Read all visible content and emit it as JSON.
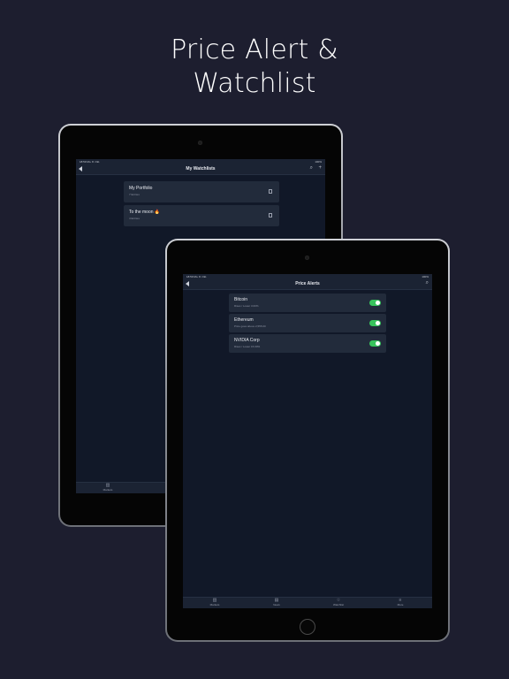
{
  "headline": {
    "line1": "Price Alert &",
    "line2": "Watchlist"
  },
  "back_device": {
    "status": {
      "left": "18:59  Mo. 8. Okt.",
      "center": "•••",
      "right": "100%"
    },
    "nav_title": "My Watchlists",
    "watchlists": [
      {
        "name": "My Portfolio",
        "subtitle": "7 Entries"
      },
      {
        "name": "To the moon 🔥",
        "subtitle": "4 Entries"
      }
    ],
    "tabs": [
      {
        "label": "Markets",
        "icon": "bar-chart-icon"
      }
    ]
  },
  "front_device": {
    "status": {
      "left": "18:59  Mo. 8. Okt.",
      "center": "•••",
      "right": "100%"
    },
    "nav_title": "Price Alerts",
    "alerts": [
      {
        "name": "Bitcoin",
        "subtitle": "Rises / Lower 3.00%",
        "enabled": true
      },
      {
        "name": "Ethereum",
        "subtitle": "Price goes above 2,555.00",
        "enabled": true
      },
      {
        "name": "NVIDIA Corp",
        "subtitle": "Rises / Lower 15.00%",
        "enabled": true
      }
    ],
    "tabs": [
      {
        "label": "Markets",
        "icon": "bar-chart-icon"
      },
      {
        "label": "News",
        "icon": "newspaper-icon"
      },
      {
        "label": "Watchlist",
        "icon": "star-icon"
      },
      {
        "label": "More",
        "icon": "menu-icon"
      }
    ]
  },
  "colors": {
    "background": "#1d1e2f",
    "screen": "#111828",
    "card": "#222b3b",
    "toggle_on": "#37c35c"
  }
}
